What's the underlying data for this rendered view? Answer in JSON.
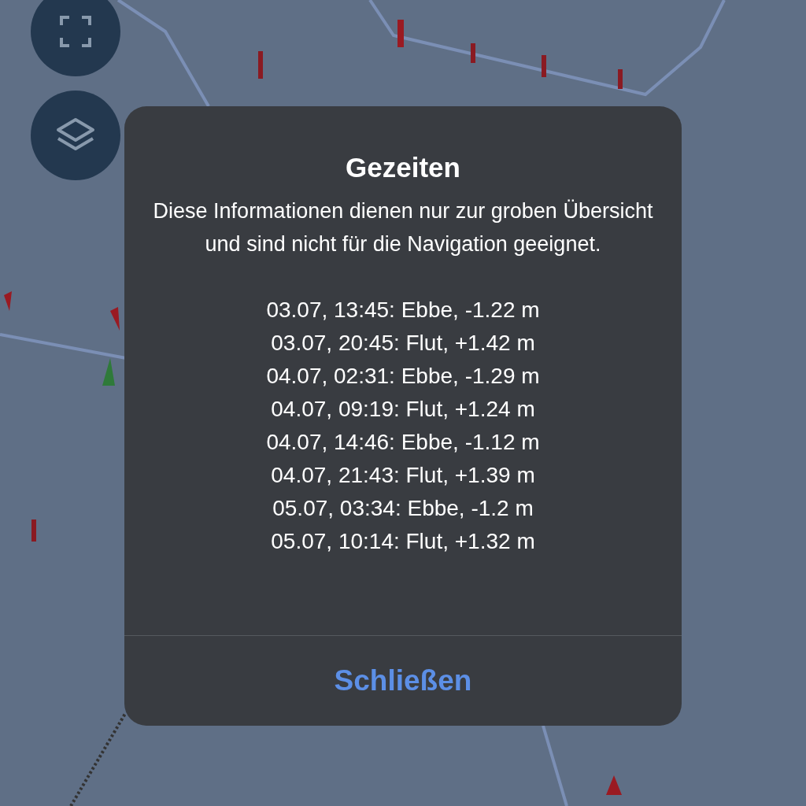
{
  "dialog": {
    "title": "Gezeiten",
    "message": "Diese Informationen dienen nur zur groben Übersicht und sind nicht für die Navigation geeignet.",
    "tides": [
      "03.07, 13:45: Ebbe, -1.22 m",
      "03.07, 20:45: Flut, +1.42 m",
      "04.07, 02:31: Ebbe, -1.29 m",
      "04.07, 09:19: Flut, +1.24 m",
      "04.07, 14:46: Ebbe, -1.12 m",
      "04.07, 21:43: Flut, +1.39 m",
      "05.07, 03:34: Ebbe, -1.2 m",
      "05.07, 10:14: Flut, +1.32 m"
    ],
    "button": "Schließen"
  }
}
